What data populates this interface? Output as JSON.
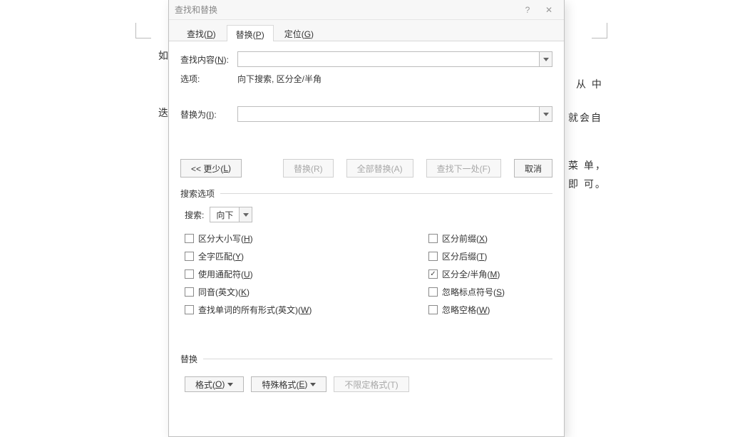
{
  "dialog": {
    "title": "查找和替换",
    "help_symbol": "?",
    "close_symbol": "✕",
    "tabs": {
      "find": {
        "text": "查找(",
        "u": "D",
        "after": ")"
      },
      "replace": {
        "text": "替换(",
        "u": "P",
        "after": ")"
      },
      "goto": {
        "text": "定位(",
        "u": "G",
        "after": ")"
      }
    },
    "find_label_text": "查找内容(",
    "find_label_u": "N",
    "find_label_after": "):",
    "find_value": "",
    "options_label": "选项:",
    "options_value": "向下搜索, 区分全/半角",
    "replace_label_text": "替换为(",
    "replace_label_u": "I",
    "replace_label_after": "):",
    "replace_value": "",
    "btn_less": "<< 更少(",
    "btn_less_u": "L",
    "btn_less_after": ")",
    "btn_replace": "替换(R)",
    "btn_replace_all": "全部替换(A)",
    "btn_find_next": "查找下一处(F)",
    "btn_cancel": "取消",
    "group_search_options": "搜索选项",
    "search_label": "搜索:",
    "search_dir": "向下",
    "checks_left": [
      {
        "text": "区分大小写(",
        "u": "H",
        "after": ")",
        "checked": false
      },
      {
        "text": "全字匹配(",
        "u": "Y",
        "after": ")",
        "checked": false
      },
      {
        "text": "使用通配符(",
        "u": "U",
        "after": ")",
        "checked": false
      },
      {
        "text": "同音(英文)(",
        "u": "K",
        "after": ")",
        "checked": false
      },
      {
        "text": "查找单词的所有形式(英文)(",
        "u": "W",
        "after": ")",
        "checked": false
      }
    ],
    "checks_right": [
      {
        "text": "区分前缀(",
        "u": "X",
        "after": ")",
        "checked": false
      },
      {
        "text": "区分后缀(",
        "u": "T",
        "after": ")",
        "checked": false
      },
      {
        "text": "区分全/半角(",
        "u": "M",
        "after": ")",
        "checked": true
      },
      {
        "text": "忽略标点符号(",
        "u": "S",
        "after": ")",
        "checked": false
      },
      {
        "text": "忽略空格(",
        "u": "W",
        "after": ")",
        "checked": false
      }
    ],
    "group_replace": "替换",
    "btn_format": {
      "text": "格式(",
      "u": "O",
      "after": ")"
    },
    "btn_special": {
      "text": "特殊格式(",
      "u": "E",
      "after": ")"
    },
    "btn_noformat": "不限定格式(T)"
  },
  "page": {
    "frag1": "如",
    "frag2a": "从 中",
    "frag2b": "迭",
    "frag2c": "就会自",
    "frag3a": "菜 单，",
    "frag3b": "即  可。"
  }
}
